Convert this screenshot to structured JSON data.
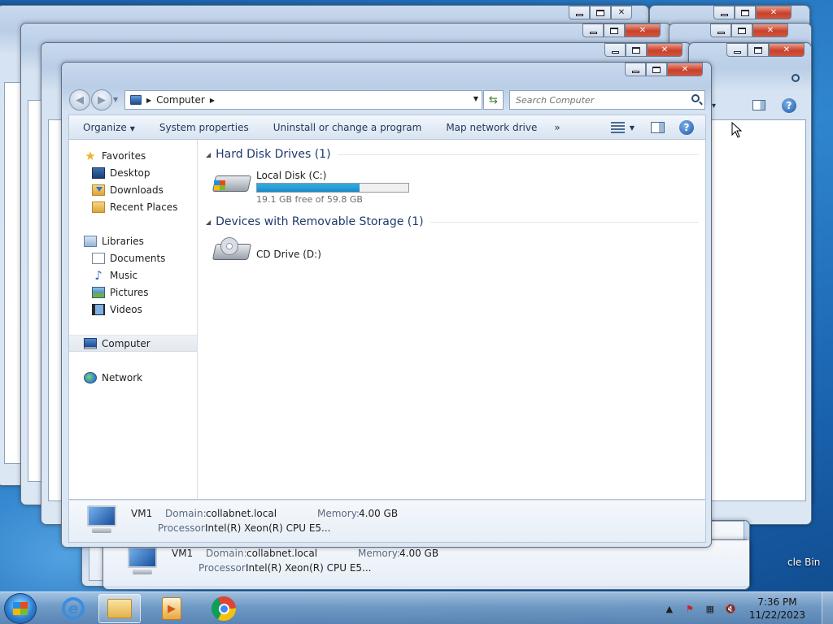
{
  "window": {
    "address_crumb": "Computer",
    "search_placeholder": "Search Computer",
    "caption": {
      "minimize": "—",
      "maximize": "□",
      "close": "✕"
    }
  },
  "commands": {
    "organize": "Organize",
    "system_properties": "System properties",
    "uninstall": "Uninstall or change a program",
    "map_drive": "Map network drive",
    "more": "»"
  },
  "nav": {
    "favorites": "Favorites",
    "desktop": "Desktop",
    "downloads": "Downloads",
    "recent_places": "Recent Places",
    "libraries": "Libraries",
    "documents": "Documents",
    "music": "Music",
    "pictures": "Pictures",
    "videos": "Videos",
    "computer": "Computer",
    "network": "Network"
  },
  "groups": {
    "hdd_title": "Hard Disk Drives (1)",
    "removable_title": "Devices with Removable Storage (1)"
  },
  "drives": {
    "c_name": "Local Disk (C:)",
    "c_free": "19.1 GB free of 59.8 GB",
    "c_used_fraction": 0.68,
    "d_name": "CD Drive (D:)"
  },
  "details": {
    "computer_name": "VM1",
    "domain_label": "Domain:",
    "domain_value": "collabnet.local",
    "memory_label": "Memory:",
    "memory_value": "4.00 GB",
    "processor_label": "Processor:",
    "processor_value": "Intel(R) Xeon(R) CPU E5..."
  },
  "desktop": {
    "recycle_label": "cle Bin"
  },
  "taskbar": {
    "time": "7:36 PM",
    "date": "11/22/2023"
  },
  "colors": {
    "accent": "#1e3a6e",
    "progress": "#26a0da",
    "close_button": "#c8412a"
  }
}
